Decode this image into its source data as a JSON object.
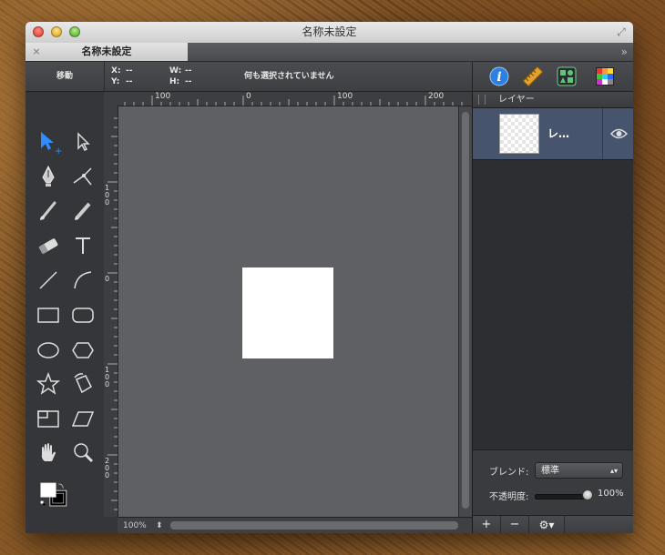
{
  "window": {
    "title": "名称未設定",
    "fullscreen_glyph": "⤢"
  },
  "tabs": [
    {
      "label": "名称未設定",
      "close": "×"
    }
  ],
  "tab_overflow": "»",
  "infobar": {
    "tool_name": "移動",
    "x_label": "X:",
    "x_value": "--",
    "y_label": "Y:",
    "y_value": "--",
    "w_label": "W:",
    "w_value": "--",
    "h_label": "H:",
    "h_value": "--",
    "selection_status": "何も選択されていません"
  },
  "inspector_icons": [
    "info-icon",
    "ruler-icon",
    "shapes-library-icon",
    "color-palette-icon"
  ],
  "ruler_top_labels": [
    "100",
    "0",
    "100",
    "200"
  ],
  "ruler_left_labels": [
    "100",
    "0",
    "100",
    "200"
  ],
  "zoom": {
    "value": "100%",
    "stepper": "⬍"
  },
  "layers_panel": {
    "title": "レイヤー",
    "layers": [
      {
        "name": "レ…",
        "visible": true
      }
    ],
    "blend_label": "ブレンド:",
    "blend_value": "標準",
    "opacity_label": "不透明度:",
    "opacity_value": "100%",
    "opacity_fraction": 1.0,
    "add": "+",
    "remove": "−",
    "settings": "⚙▾"
  },
  "colors": {
    "fill": "#ffffff",
    "stroke": "#000000",
    "selection": "#47546d",
    "accent": "#2f8cff"
  }
}
